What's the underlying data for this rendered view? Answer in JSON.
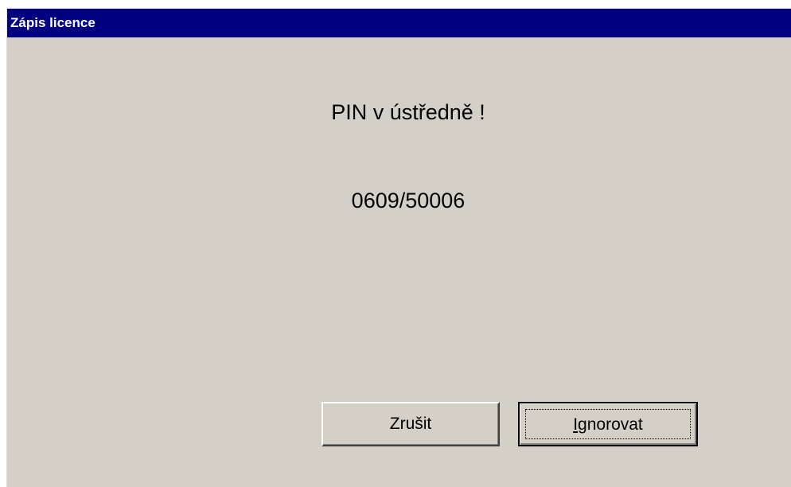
{
  "window": {
    "title": "Zápis licence",
    "title_bar_color": "#000080",
    "background_color": "#d4d0c8"
  },
  "message": {
    "heading": "PIN v ústředně !",
    "pin": "0609/50006"
  },
  "buttons": {
    "cancel_label": "Zrušit",
    "ignore_mnemonic": "I",
    "ignore_rest": "gnorovat",
    "focused": "ignore"
  }
}
